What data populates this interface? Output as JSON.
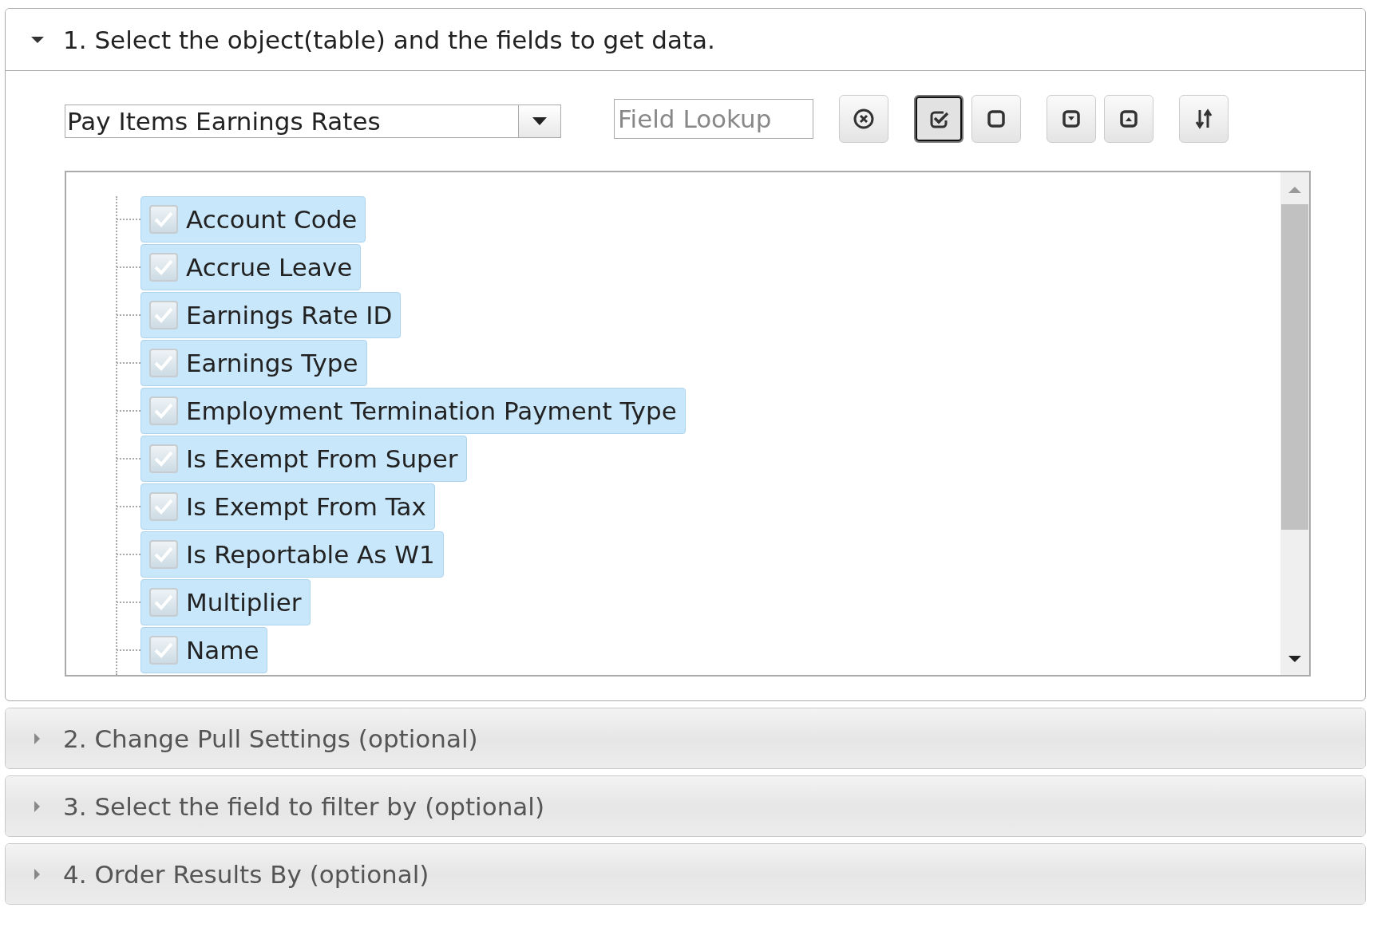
{
  "sections": [
    {
      "title": "1. Select the object(table) and the fields to get data.",
      "expanded": true
    },
    {
      "title": "2. Change Pull Settings (optional)",
      "expanded": false
    },
    {
      "title": "3. Select the field to filter by (optional)",
      "expanded": false
    },
    {
      "title": "4. Order Results By (optional)",
      "expanded": false
    }
  ],
  "object_select": {
    "value": "Pay Items Earnings Rates"
  },
  "field_lookup": {
    "placeholder": "Field Lookup"
  },
  "toolbar": [
    {
      "kind": "clear",
      "selected": false
    },
    {
      "kind": "check_all",
      "selected": true
    },
    {
      "kind": "uncheck_all",
      "selected": false
    },
    {
      "kind": "expand",
      "selected": false
    },
    {
      "kind": "collapse",
      "selected": false
    },
    {
      "kind": "sort",
      "selected": false
    }
  ],
  "fields": [
    {
      "label": "Account Code",
      "checked": true
    },
    {
      "label": "Accrue Leave",
      "checked": true
    },
    {
      "label": "Earnings Rate ID",
      "checked": true
    },
    {
      "label": "Earnings Type",
      "checked": true
    },
    {
      "label": "Employment Termination Payment Type",
      "checked": true
    },
    {
      "label": "Is Exempt From Super",
      "checked": true
    },
    {
      "label": "Is Exempt From Tax",
      "checked": true
    },
    {
      "label": "Is Reportable As W1",
      "checked": true
    },
    {
      "label": "Multiplier",
      "checked": true
    },
    {
      "label": "Name",
      "checked": true
    }
  ]
}
